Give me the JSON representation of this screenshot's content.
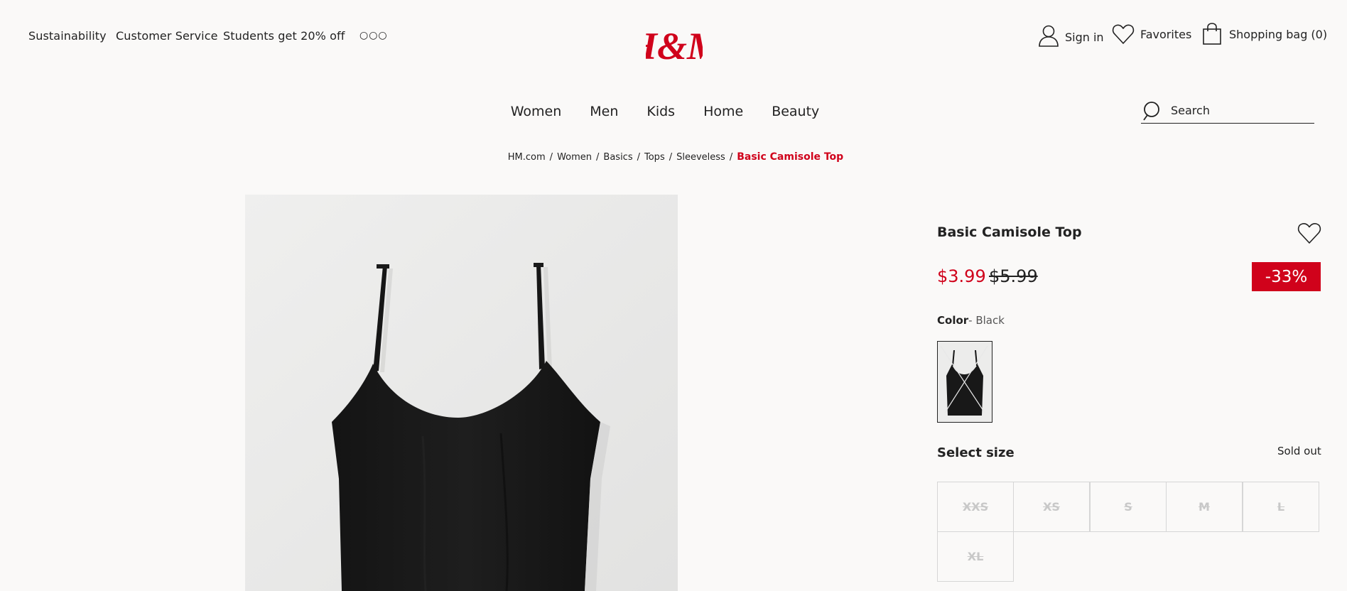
{
  "header": {
    "top_links": [
      "Sustainability",
      "Customer Service",
      "Students get 20% off"
    ],
    "more_icon": "more-dots-icon",
    "logo_text": "H&M",
    "sign_in": "Sign in",
    "favorites": "Favorites",
    "bag": "Shopping bag (0)"
  },
  "nav": {
    "items": [
      "Women",
      "Men",
      "Kids",
      "Home",
      "Beauty"
    ],
    "search_placeholder": "Search"
  },
  "breadcrumb": {
    "items": [
      "HM.com",
      "Women",
      "Basics",
      "Tops",
      "Sleeveless"
    ],
    "current": "Basic Camisole Top",
    "separator": "/"
  },
  "product": {
    "title": "Basic Camisole Top",
    "price_sale": "$3.99",
    "price_original": "$5.99",
    "discount": "-33%",
    "color_label": "Color",
    "color_value": "- Black",
    "size_label": "Select size",
    "availability": "Sold out",
    "sizes": [
      "XXS",
      "XS",
      "S",
      "M",
      "L",
      "XL"
    ]
  },
  "colors": {
    "brand_red": "#d0021b",
    "background": "#faf9f8",
    "text": "#222222"
  }
}
